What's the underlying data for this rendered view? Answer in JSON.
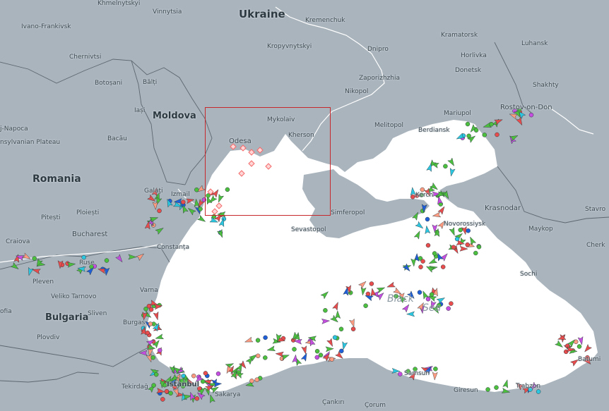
{
  "map": {
    "colors": {
      "land": "#aab4bd",
      "sea": "#ffffff",
      "border": "#5c6770",
      "river": "#ffffff",
      "selection": "#c6282b"
    },
    "country_labels": [
      "Ukraine",
      "Moldova",
      "Romania",
      "Bulgaria"
    ],
    "sea_labels": [
      "Black",
      "Sea"
    ],
    "city_labels": [
      "Khmelnytskyi",
      "Vinnytsia",
      "Kremenchuk",
      "Ivano-Frankivsk",
      "Kramatorsk",
      "Kropyvnytskyi",
      "Dnipro",
      "Luhansk",
      "Horlivka",
      "Chernivtsi",
      "Donetsk",
      "Zaporizhzhia",
      "Shakhty",
      "Botoșani",
      "Bălți",
      "Nikopol",
      "Iași",
      "Rostov-on-Don",
      "Mariupol",
      "Mykolaiv",
      "Melitopol",
      "Berdiansk",
      "j-Napoca",
      "Kherson",
      "Bacău",
      "nsylvanian Plateau",
      "Odesa",
      "Galați",
      "Izmail",
      "Kerch",
      "Krasnodar",
      "Stavro",
      "Simferopol",
      "Ploiești",
      "Novorossiysk",
      "Pitești",
      "Sevastopol",
      "Maykop",
      "Bucharest",
      "Craiova",
      "Constanța",
      "Cherk",
      "Ruse",
      "Sochi",
      "Pleven",
      "Varna",
      "Veliko Tarnovo",
      "Sliven",
      "ofia",
      "Burgas",
      "Plovdiv",
      "Batumi",
      "Samsun",
      "Tekirdağ",
      "Istanbul",
      "Giresun",
      "Trabzon",
      "Sakarya",
      "Çankırı",
      "Çorum"
    ],
    "vessel_colors": {
      "cargo": "#4cbf3f",
      "tanker": "#e84c4c",
      "passenger": "#2bc6e0",
      "pleasure": "#c54de0",
      "tug": "#1e5fd8",
      "unspecified": "#ff9b80",
      "selected": "#f46a6a"
    }
  }
}
